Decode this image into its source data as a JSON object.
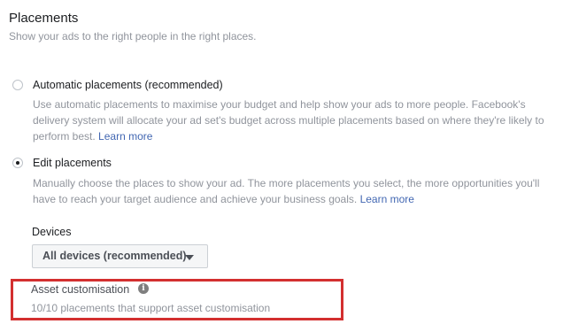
{
  "header": {
    "title": "Placements",
    "subtitle": "Show your ads to the right people in the right places."
  },
  "options": [
    {
      "label": "Automatic placements (recommended)",
      "selected": false,
      "description": "Use automatic placements to maximise your budget and help show your ads to more people. Facebook's delivery system will allocate your ad set's budget across multiple placements based on where they're likely to perform best.",
      "link_text": "Learn more"
    },
    {
      "label": "Edit placements",
      "selected": true,
      "description": "Manually choose the places to show your ad. The more placements you select, the more opportunities you'll have to reach your target audience and achieve your business goals.",
      "link_text": "Learn more"
    }
  ],
  "devices": {
    "label": "Devices",
    "selected_value": "All devices (recommended)"
  },
  "asset_customisation": {
    "label": "Asset customisation",
    "info_icon": "info-icon",
    "info_glyph": "i",
    "value": "10/10 placements that support asset customisation"
  },
  "colors": {
    "link": "#4267b2",
    "highlight_border": "#d32f2f",
    "muted_text": "#90949c"
  }
}
